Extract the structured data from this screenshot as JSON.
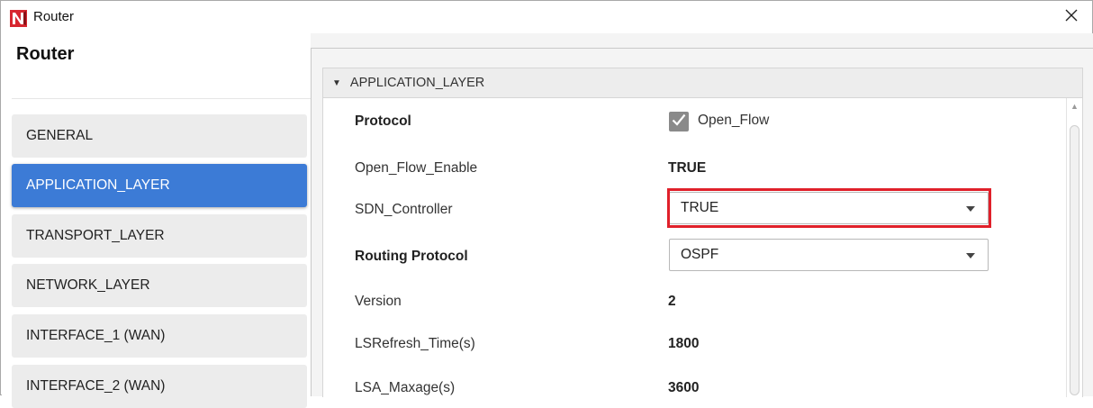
{
  "window": {
    "title": "Router",
    "close_glyph": "✕"
  },
  "sidebar": {
    "title": "Router",
    "items": [
      {
        "label": "GENERAL",
        "active": false
      },
      {
        "label": "APPLICATION_LAYER",
        "active": true
      },
      {
        "label": "TRANSPORT_LAYER",
        "active": false
      },
      {
        "label": "NETWORK_LAYER",
        "active": false
      },
      {
        "label": "INTERFACE_1 (WAN)",
        "active": false
      },
      {
        "label": "INTERFACE_2 (WAN)",
        "active": false
      }
    ]
  },
  "section": {
    "title": "APPLICATION_LAYER",
    "expanded": true
  },
  "properties": {
    "protocol": {
      "label": "Protocol",
      "checkbox_label": "Open_Flow",
      "checked": true
    },
    "open_flow_enable": {
      "label": "Open_Flow_Enable",
      "value": "TRUE"
    },
    "sdn_controller": {
      "label": "SDN_Controller",
      "value": "TRUE"
    },
    "routing_protocol": {
      "label": "Routing Protocol",
      "value": "OSPF"
    },
    "version": {
      "label": "Version",
      "value": "2"
    },
    "lsrefresh_time": {
      "label": "LSRefresh_Time(s)",
      "value": "1800"
    },
    "lsa_maxage": {
      "label": "LSA_Maxage(s)",
      "value": "3600"
    }
  },
  "colors": {
    "accent": "#3c7bd6",
    "highlight_border": "#e0202a",
    "logo_red": "#d7262f"
  },
  "icons": {
    "app": "netsim-logo-icon",
    "close": "close-icon",
    "collapse": "triangle-down-icon",
    "dropdown": "chevron-down-icon",
    "check": "check-icon"
  }
}
